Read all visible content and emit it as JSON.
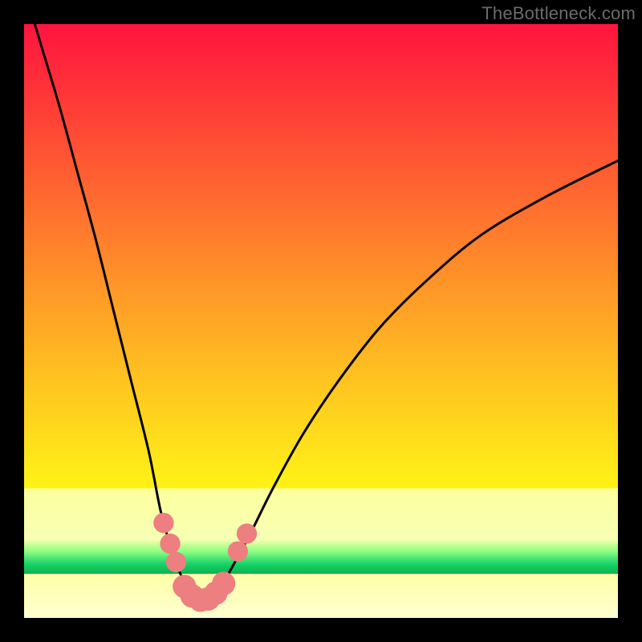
{
  "watermark": "TheBottleneck.com",
  "colors": {
    "frame": "#000000",
    "curve_stroke": "#000000",
    "marker_fill": "#ed7f80",
    "gradient_top": "#ff153e",
    "gradient_mid": "#ffe31a",
    "gradient_band": "#fdff9d",
    "gradient_green": "#1dd66a"
  },
  "chart_data": {
    "type": "line",
    "title": "",
    "xlabel": "",
    "ylabel": "",
    "xlim": [
      0,
      100
    ],
    "ylim": [
      0,
      100
    ],
    "series": [
      {
        "name": "bottleneck-curve",
        "x": [
          0,
          3,
          6,
          9,
          12,
          15,
          18,
          21,
          23,
          25,
          26.5,
          28,
          29,
          30,
          31,
          33,
          35,
          38,
          42,
          47,
          53,
          60,
          68,
          77,
          88,
          100
        ],
        "y": [
          106,
          96,
          86,
          75,
          64,
          52,
          40,
          28,
          18,
          11,
          7,
          4.5,
          3.2,
          3,
          3.5,
          5,
          8.5,
          14,
          22,
          31,
          40,
          49,
          57,
          64.5,
          71,
          77
        ]
      }
    ],
    "markers": [
      {
        "x": 23.5,
        "y": 16,
        "r": 1.3
      },
      {
        "x": 24.6,
        "y": 12.5,
        "r": 1.3
      },
      {
        "x": 25.6,
        "y": 9.4,
        "r": 1.3
      },
      {
        "x": 27.0,
        "y": 5.3,
        "r": 1.6
      },
      {
        "x": 28.3,
        "y": 3.7,
        "r": 1.6
      },
      {
        "x": 29.7,
        "y": 3.0,
        "r": 1.6
      },
      {
        "x": 31.0,
        "y": 3.2,
        "r": 1.6
      },
      {
        "x": 32.3,
        "y": 4.2,
        "r": 1.6
      },
      {
        "x": 33.6,
        "y": 5.8,
        "r": 1.6
      },
      {
        "x": 36.0,
        "y": 11.2,
        "r": 1.3
      },
      {
        "x": 37.5,
        "y": 14.2,
        "r": 1.3
      }
    ]
  }
}
